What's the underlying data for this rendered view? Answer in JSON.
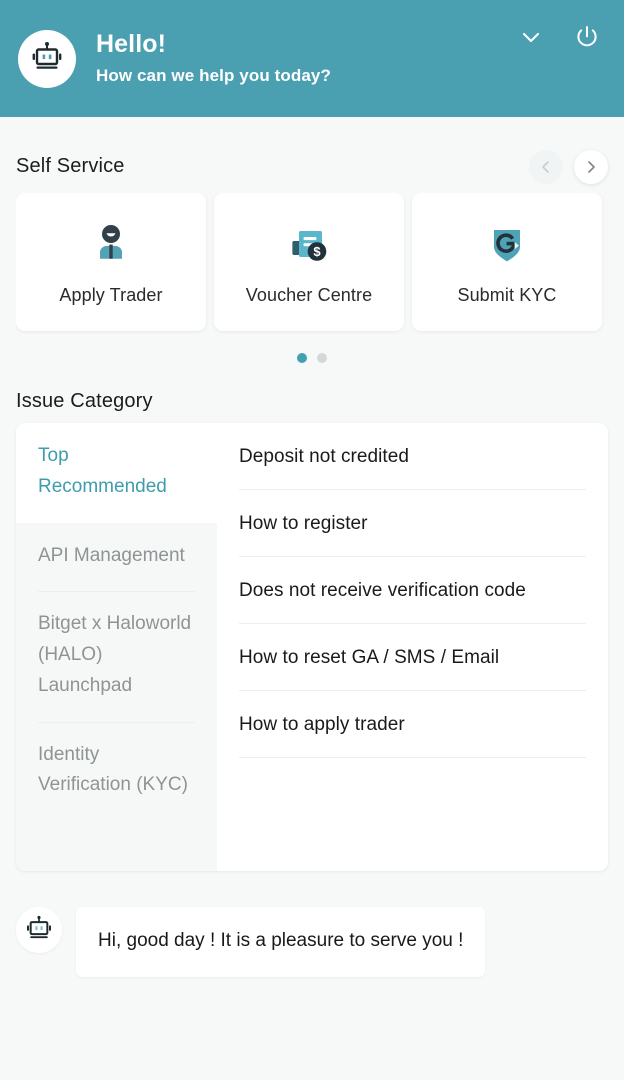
{
  "theme": {
    "header_bg": "#4a9fb1",
    "accent": "#43a0b3",
    "page_bg": "#f7f9f9",
    "card_bg": "#ffffff",
    "muted_text": "#8e9495"
  },
  "header": {
    "avatar_icon": "robot-icon",
    "title": "Hello!",
    "subtitle": "How can we help you today?",
    "minimize_icon": "chevron-down-icon",
    "close_icon": "power-icon"
  },
  "self_service": {
    "title": "Self Service",
    "prev_icon": "chevron-left-icon",
    "next_icon": "chevron-right-icon",
    "cards": [
      {
        "label": "Apply Trader",
        "icon": "person-trader-icon"
      },
      {
        "label": "Voucher Centre",
        "icon": "voucher-dollar-icon"
      },
      {
        "label": "Submit KYC",
        "icon": "shield-refresh-icon"
      },
      {
        "label": "",
        "icon": ""
      }
    ],
    "pagination": {
      "total": 2,
      "active_index": 0
    }
  },
  "issue_category": {
    "title": "Issue Category",
    "categories": [
      {
        "label": "Top Recommended",
        "active": true
      },
      {
        "label": "API Management",
        "active": false
      },
      {
        "label": "Bitget x Haloworld (HALO) Launchpad",
        "active": false
      },
      {
        "label": "Identity Verification (KYC)",
        "active": false
      }
    ],
    "items": [
      "Deposit not credited",
      "How to register",
      "Does not receive verification code",
      "How to reset GA / SMS / Email",
      "How to apply trader"
    ]
  },
  "chat": {
    "avatar_icon": "robot-icon",
    "message": "Hi, good day ! It is a pleasure to serve you !"
  }
}
